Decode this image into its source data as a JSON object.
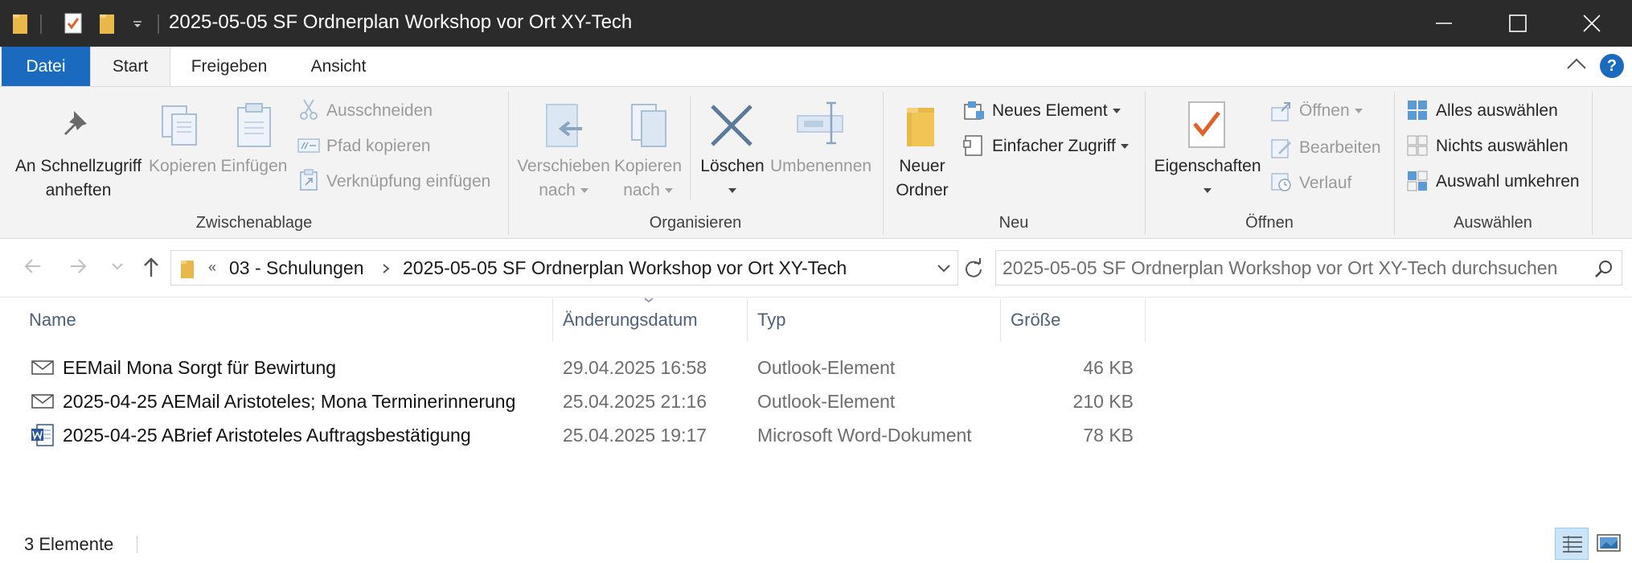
{
  "window": {
    "title": "2025-05-05 SF Ordnerplan Workshop vor Ort XY-Tech"
  },
  "tabs": [
    {
      "label": "Datei"
    },
    {
      "label": "Start"
    },
    {
      "label": "Freigeben"
    },
    {
      "label": "Ansicht"
    }
  ],
  "ribbon": {
    "clipboard": {
      "pin_line1": "An Schnellzugriff",
      "pin_line2": "anheften",
      "copy": "Kopieren",
      "paste": "Einfügen",
      "cut": "Ausschneiden",
      "copy_path": "Pfad kopieren",
      "paste_shortcut": "Verknüpfung einfügen",
      "label": "Zwischenablage"
    },
    "organize": {
      "move_line1": "Verschieben",
      "move_line2": "nach",
      "copyto_line1": "Kopieren",
      "copyto_line2": "nach",
      "delete": "Löschen",
      "rename": "Umbenennen",
      "label": "Organisieren"
    },
    "new": {
      "folder_line1": "Neuer",
      "folder_line2": "Ordner",
      "new_item": "Neues Element",
      "easy_access": "Einfacher Zugriff",
      "label": "Neu"
    },
    "open": {
      "properties": "Eigenschaften",
      "open": "Öffnen",
      "edit": "Bearbeiten",
      "history": "Verlauf",
      "label": "Öffnen"
    },
    "select": {
      "select_all": "Alles auswählen",
      "select_none": "Nichts auswählen",
      "invert": "Auswahl umkehren",
      "label": "Auswählen"
    }
  },
  "address": {
    "overflow": "«",
    "crumbs": [
      "03 - Schulungen",
      "2025-05-05 SF Ordnerplan Workshop vor Ort XY-Tech"
    ],
    "search_placeholder": "2025-05-05 SF Ordnerplan Workshop vor Ort XY-Tech durchsuchen"
  },
  "columns": {
    "name": "Name",
    "date": "Änderungsdatum",
    "type": "Typ",
    "size": "Größe"
  },
  "files": [
    {
      "name": "EEMail Mona Sorgt für Bewirtung",
      "date": "29.04.2025 16:58",
      "type": "Outlook-Element",
      "size": "46 KB",
      "icon": "mail-icon"
    },
    {
      "name": "2025-04-25 AEMail Aristoteles; Mona Terminerinnerung",
      "date": "25.04.2025 21:16",
      "type": "Outlook-Element",
      "size": "210 KB",
      "icon": "mail-icon"
    },
    {
      "name": "2025-04-25 ABrief Aristoteles Auftragsbestätigung",
      "date": "25.04.2025 19:17",
      "type": "Microsoft Word-Dokument",
      "size": "78 KB",
      "icon": "word-doc-icon"
    }
  ],
  "status": {
    "count": "3 Elemente"
  },
  "colors": {
    "accent": "#1a6bbf",
    "titlebar": "#2b2b2b",
    "ribbon": "#f3f3f3"
  }
}
